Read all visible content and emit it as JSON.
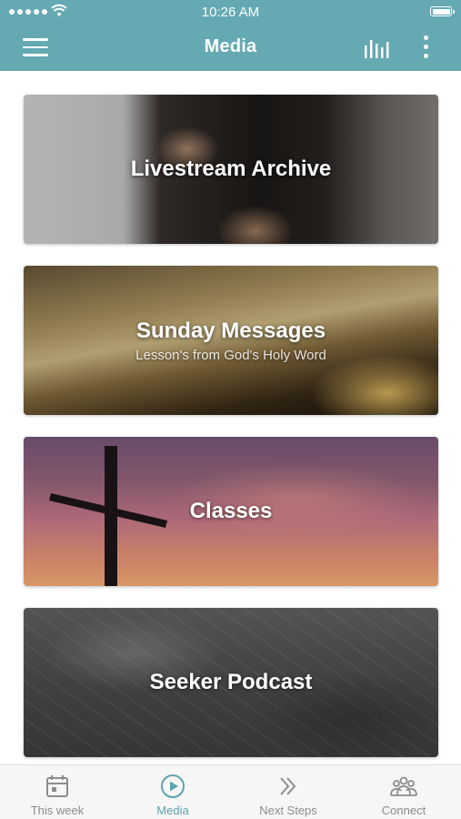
{
  "status_bar": {
    "time": "10:26 AM"
  },
  "header": {
    "title": "Media"
  },
  "colors": {
    "accent": "#65a9b3",
    "tab_active": "#5fa3ad",
    "tab_inactive": "#8c8c8c"
  },
  "cards": [
    {
      "title": "Livestream Archive",
      "subtitle": ""
    },
    {
      "title": "Sunday Messages",
      "subtitle": "Lesson's from God's Holy Word"
    },
    {
      "title": "Classes",
      "subtitle": ""
    },
    {
      "title": "Seeker Podcast",
      "subtitle": ""
    }
  ],
  "tabs": [
    {
      "label": "This week",
      "icon": "calendar-icon",
      "active": false
    },
    {
      "label": "Media",
      "icon": "play-circle-icon",
      "active": true
    },
    {
      "label": "Next Steps",
      "icon": "double-chevron-right-icon",
      "active": false
    },
    {
      "label": "Connect",
      "icon": "people-icon",
      "active": false
    }
  ]
}
